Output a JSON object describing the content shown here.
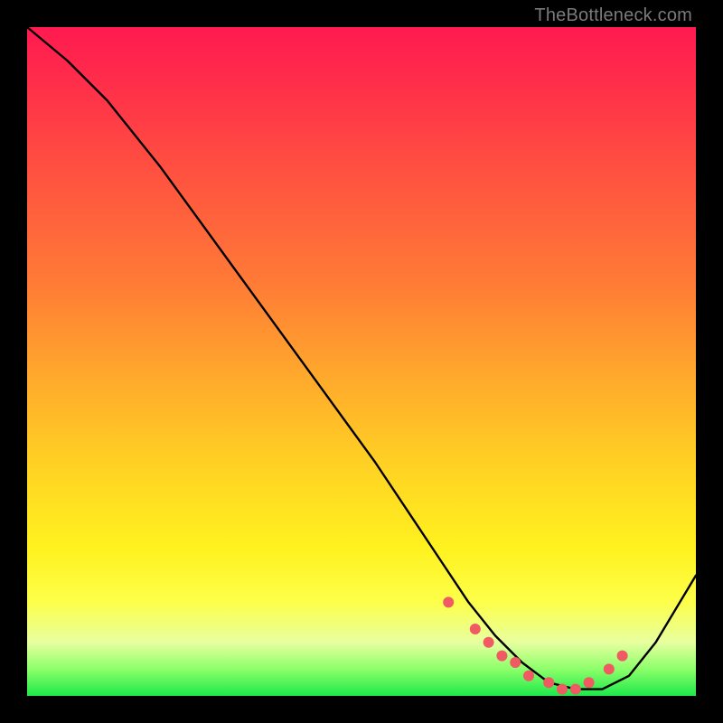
{
  "watermark": "TheBottleneck.com",
  "chart_data": {
    "type": "line",
    "title": "",
    "xlabel": "",
    "ylabel": "",
    "xlim": [
      0,
      100
    ],
    "ylim": [
      0,
      100
    ],
    "series": [
      {
        "name": "bottleneck-curve",
        "x": [
          0,
          6,
          12,
          20,
          28,
          36,
          44,
          52,
          58,
          62,
          66,
          70,
          74,
          78,
          82,
          86,
          90,
          94,
          100
        ],
        "y": [
          100,
          95,
          89,
          79,
          68,
          57,
          46,
          35,
          26,
          20,
          14,
          9,
          5,
          2,
          1,
          1,
          3,
          8,
          18
        ]
      }
    ],
    "markers": {
      "name": "trough-points",
      "x": [
        63,
        67,
        69,
        71,
        73,
        75,
        78,
        80,
        82,
        84,
        87,
        89
      ],
      "y": [
        14,
        10,
        8,
        6,
        5,
        3,
        2,
        1,
        1,
        2,
        4,
        6
      ]
    },
    "colors": {
      "curve": "#000000",
      "marker": "#ef5a63"
    }
  }
}
